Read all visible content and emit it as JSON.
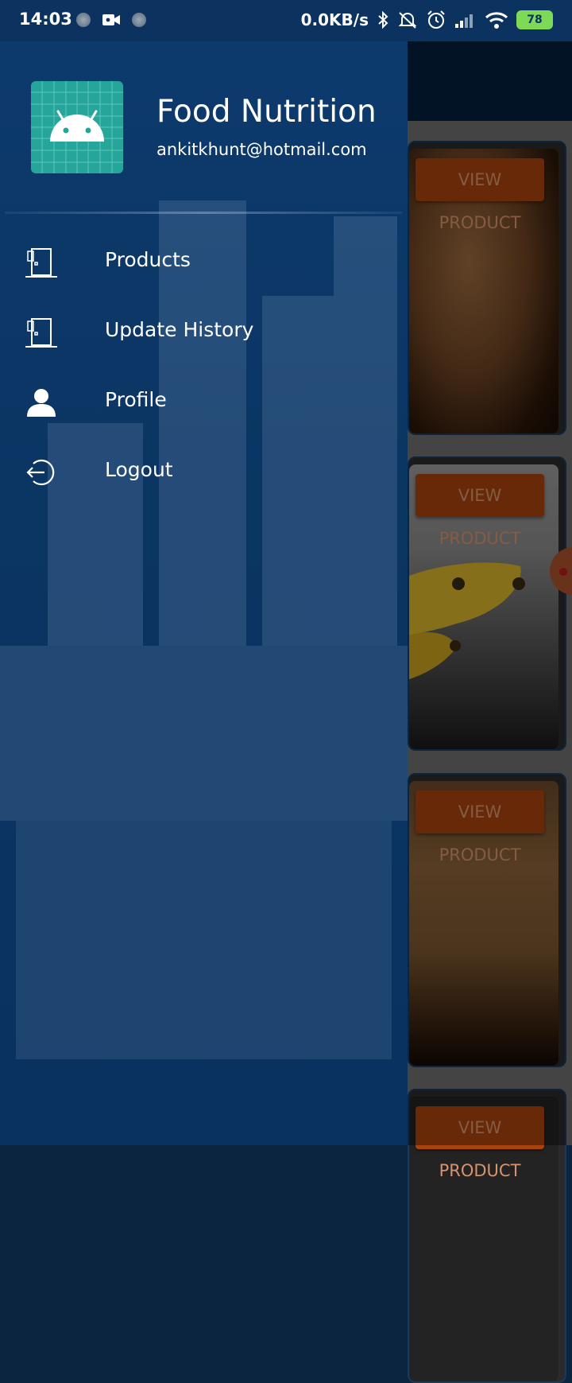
{
  "status_bar": {
    "time": "14:03",
    "network_speed": "0.0KB/s",
    "battery_level": "78",
    "icons": [
      "notification-dot-icon",
      "video-camera-icon",
      "notification-dot-icon",
      "bluetooth-icon",
      "mute-icon",
      "alarm-icon",
      "signal-icon",
      "wifi-icon",
      "battery-icon"
    ]
  },
  "drawer": {
    "app_name": "Food Nutrition",
    "email": "ankitkhunt@hotmail.com",
    "logo_icon": "android-logo-icon",
    "items": [
      {
        "label": "Products",
        "icon": "door-icon"
      },
      {
        "label": "Update History",
        "icon": "door-icon"
      },
      {
        "label": "Profile",
        "icon": "person-icon"
      },
      {
        "label": "Logout",
        "icon": "logout-icon"
      }
    ]
  },
  "background_list": {
    "cards": [
      {
        "button_label": "VIEW PRODUCT",
        "image": "almonds"
      },
      {
        "button_label": "VIEW PRODUCT",
        "image": "bananas"
      },
      {
        "button_label": "VIEW PRODUCT",
        "image": "bread"
      },
      {
        "button_label": "VIEW PRODUCT",
        "image": "unknown"
      }
    ]
  },
  "colors": {
    "drawer_background": "#0b3563",
    "status_bar": "#0c3360",
    "accent_button": "#a8430e",
    "logo_background": "#26a69a"
  }
}
